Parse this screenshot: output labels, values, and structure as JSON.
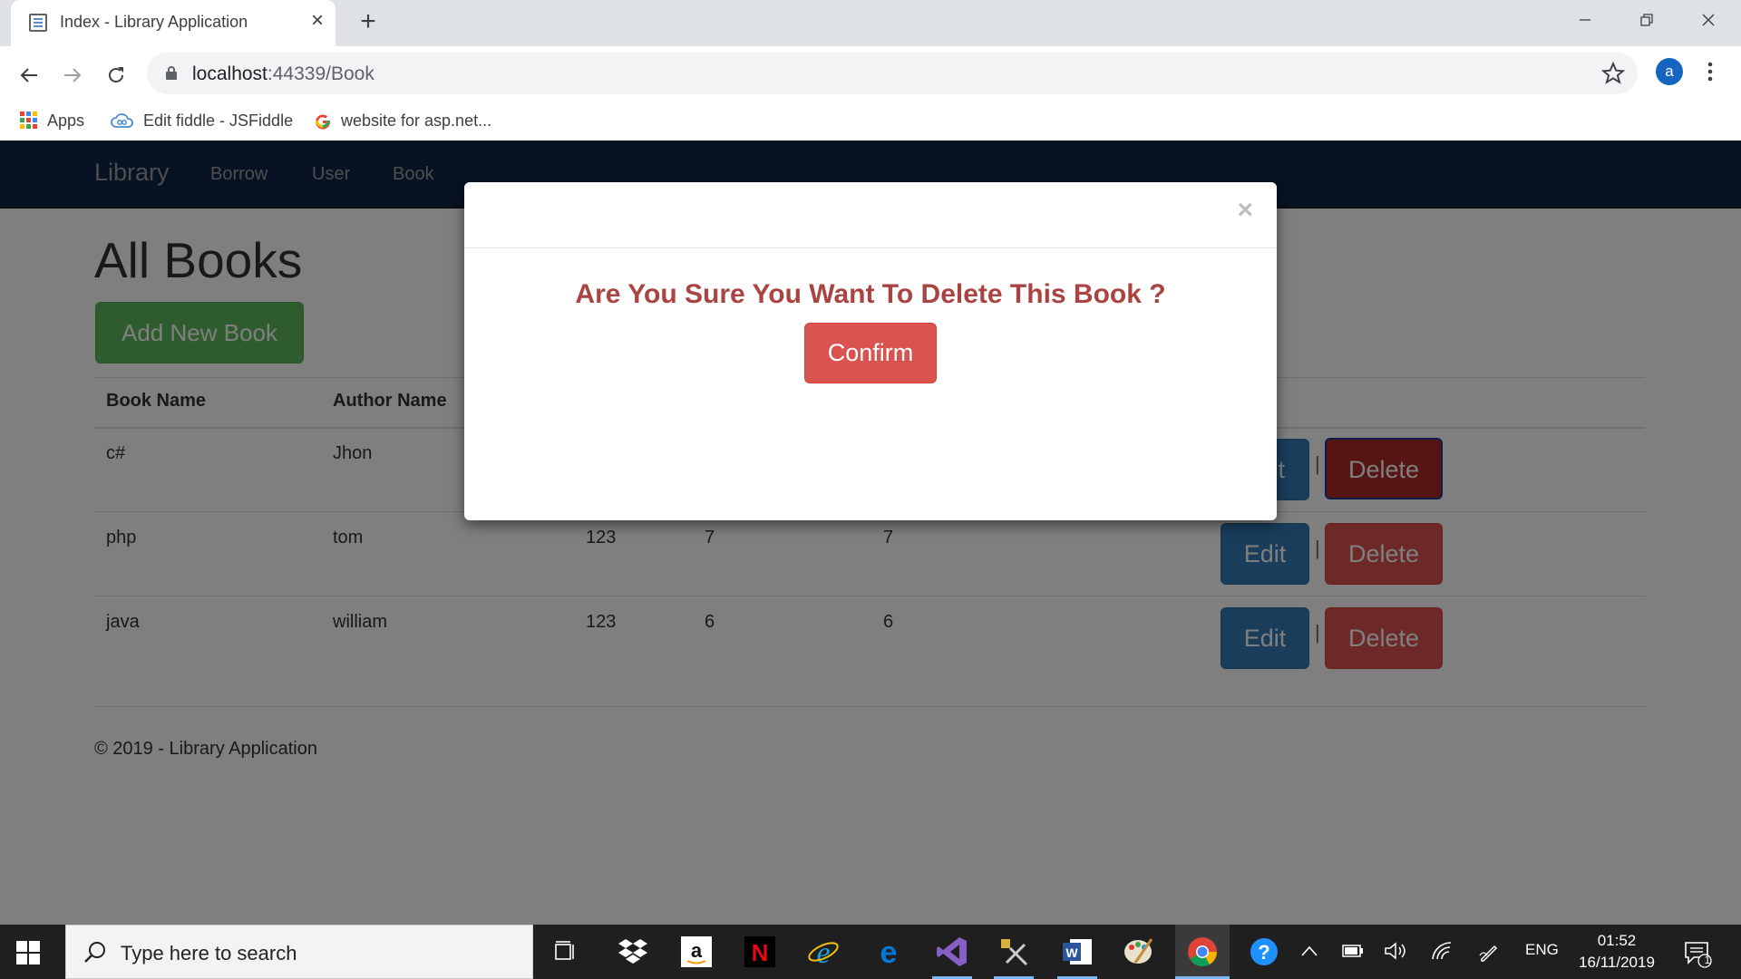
{
  "browser": {
    "tab_title": "Index - Library Application",
    "url_host": "localhost",
    "url_rest": ":44339/Book",
    "profile_initial": "a",
    "bookmarks": [
      {
        "label": "Apps"
      },
      {
        "label": "Edit fiddle - JSFiddle"
      },
      {
        "label": "website for asp.net..."
      }
    ]
  },
  "navbar": {
    "brand": "Library",
    "links": [
      "Borrow",
      "User",
      "Book"
    ]
  },
  "page": {
    "title": "All Books",
    "add_button": "Add New Book",
    "columns": [
      "Book Name",
      "Author Name"
    ],
    "rows": [
      {
        "book": "c#",
        "author": "Jhon",
        "c3": "",
        "c4": "",
        "c5": ""
      },
      {
        "book": "php",
        "author": "tom",
        "c3": "123",
        "c4": "7",
        "c5": "7"
      },
      {
        "book": "java",
        "author": "william",
        "c3": "123",
        "c4": "6",
        "c5": "6"
      }
    ],
    "edit_label": "Edit",
    "delete_label": "Delete",
    "edit_partial": "t",
    "separator": "|",
    "footer": "© 2019 - Library Application"
  },
  "modal": {
    "close_symbol": "×",
    "message": "Are You Sure You Want To Delete This Book ?",
    "confirm_label": "Confirm"
  },
  "taskbar": {
    "search_placeholder": "Type here to search",
    "language": "ENG",
    "time": "01:52",
    "date": "16/11/2019",
    "notification_count": "1"
  },
  "colors": {
    "navbar": "#0e2444",
    "success": "#5cb85c",
    "primary": "#337ab7",
    "danger": "#d9534f",
    "danger_text": "#a94442"
  }
}
